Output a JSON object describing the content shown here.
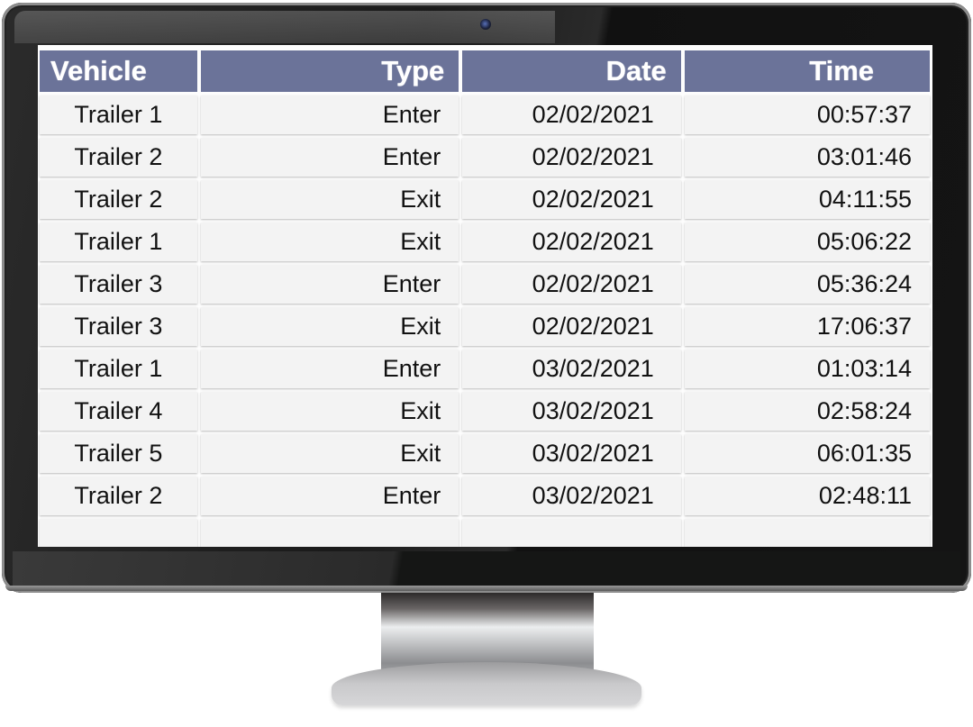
{
  "table": {
    "headers": [
      "Vehicle",
      "Type",
      "Date",
      "Time"
    ],
    "rows": [
      [
        "Trailer 1",
        "Enter",
        "02/02/2021",
        "00:57:37"
      ],
      [
        "Trailer 2",
        "Enter",
        "02/02/2021",
        "03:01:46"
      ],
      [
        "Trailer 2",
        "Exit",
        "02/02/2021",
        "04:11:55"
      ],
      [
        "Trailer 1",
        "Exit",
        "02/02/2021",
        "05:06:22"
      ],
      [
        "Trailer 3",
        "Enter",
        "02/02/2021",
        "05:36:24"
      ],
      [
        "Trailer 3",
        "Exit",
        "02/02/2021",
        "17:06:37"
      ],
      [
        "Trailer 1",
        "Enter",
        "03/02/2021",
        "01:03:14"
      ],
      [
        "Trailer 4",
        "Exit",
        "03/02/2021",
        "02:58:24"
      ],
      [
        "Trailer 5",
        "Exit",
        "03/02/2021",
        "06:01:35"
      ],
      [
        "Trailer 2",
        "Enter",
        "03/02/2021",
        "02:48:11"
      ],
      [
        "",
        "",
        "",
        ""
      ]
    ]
  },
  "colors": {
    "header_bg": "#6b7399",
    "header_text": "#ffffff",
    "cell_bg": "#f3f3f3"
  },
  "icons": {
    "camera": "webcam-icon"
  }
}
